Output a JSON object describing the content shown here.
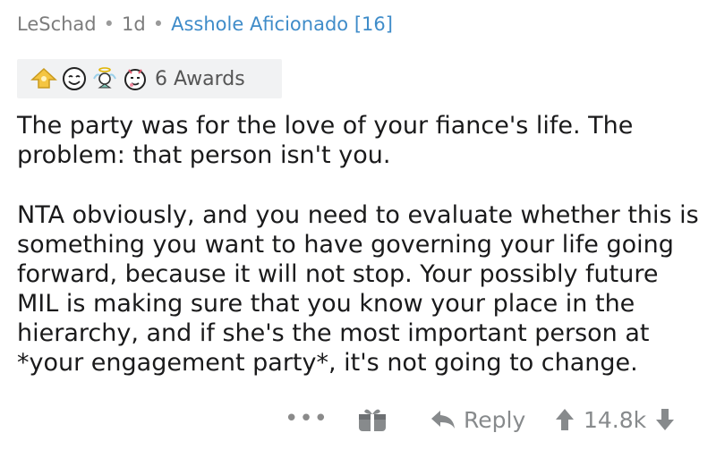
{
  "comment": {
    "author": "LeSchad",
    "separator": "•",
    "age": "1d",
    "flair": "Asshole Aficionado [16]",
    "awards": {
      "icons": [
        "silver-award-icon",
        "wholesome-face-award-icon",
        "angel-award-icon",
        "hugz-award-icon"
      ],
      "count_label": "6 Awards"
    },
    "body": {
      "paragraph1": "The party was for the love of your fiance's life. The problem: that person isn't you.",
      "paragraph2": "NTA obviously, and you need to evaluate whether this is something you want to have governing your life going forward, because it will not stop. Your possibly future MIL is making sure that you know your place in the hierarchy, and if she's the most important person at *your engagement party*, it's not going to change."
    }
  },
  "actions": {
    "more_label": "•••",
    "reply_label": "Reply",
    "score": "14.8k"
  },
  "colors": {
    "flair": "#3f8cc9",
    "meta": "#7c7c7c",
    "text": "#1a1a1b",
    "action": "#878a8c",
    "award_bg": "#f1f2f3"
  }
}
